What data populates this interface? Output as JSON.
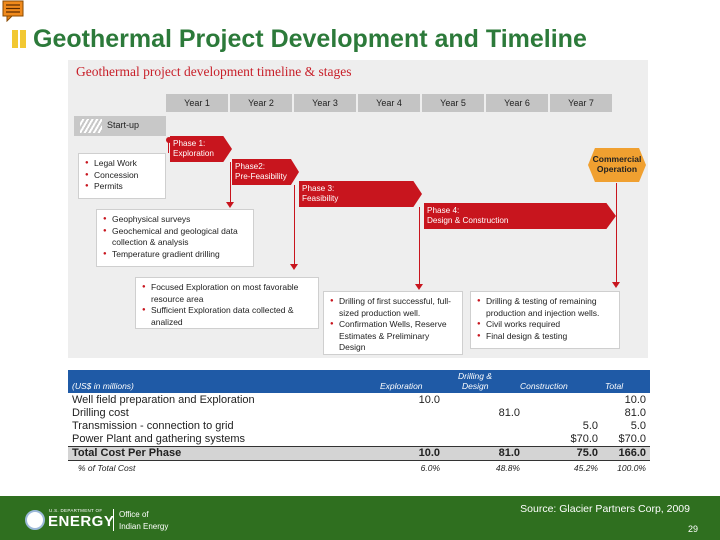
{
  "slide": {
    "title": "Geothermal Project Development and Timeline",
    "page_number": "29",
    "source": "Source: Glacier Partners Corp, 2009"
  },
  "diagram": {
    "title": "Geothermal project development timeline & stages",
    "years": [
      "Year 1",
      "Year 2",
      "Year 3",
      "Year 4",
      "Year 5",
      "Year 6",
      "Year 7"
    ],
    "startup": "Start-up",
    "phases": [
      {
        "line1": "Phase 1:",
        "line2": "Exploration"
      },
      {
        "line1": "Phase2:",
        "line2": "Pre-Feasibility"
      },
      {
        "line1": "Phase 3:",
        "line2": "Feasibility"
      },
      {
        "line1": "Phase 4:",
        "line2": "Design & Construction"
      }
    ],
    "commercial": {
      "line1": "Commercial",
      "line2": "Operation"
    },
    "boxes": [
      [
        "Legal Work",
        "Concession",
        "Permits"
      ],
      [
        "Geophysical surveys",
        "Geochemical and geological data collection & analysis",
        "Temperature gradient drilling"
      ],
      [
        "Focused Exploration on most favorable resource area",
        "Sufficient Exploration data collected & analized"
      ],
      [
        "Drilling of first successful, full-sized production well.",
        "Confirmation Wells, Reserve Estimates & Preliminary Design"
      ],
      [
        "Drilling & testing of remaining production and injection wells.",
        "Civil works required",
        "Final design & testing"
      ]
    ]
  },
  "table": {
    "header": {
      "units": "(US$ in millions)",
      "col1": "Exploration",
      "col2_line1": "Drilling &",
      "col2_line2": "Design",
      "col3": "Construction",
      "col4": "Total"
    },
    "rows": [
      {
        "label": "Well field preparation and Exploration",
        "exploration": "10.0",
        "drilling": "",
        "construction": "",
        "total": "10.0"
      },
      {
        "label": "Drilling cost",
        "exploration": "",
        "drilling": "81.0",
        "construction": "",
        "total": "81.0"
      },
      {
        "label": "Transmission - connection to grid",
        "exploration": "",
        "drilling": "",
        "construction": "5.0",
        "total": "5.0"
      },
      {
        "label": "Power Plant and gathering systems",
        "exploration": "",
        "drilling": "",
        "construction": "$70.0",
        "total": "$70.0"
      }
    ],
    "total_row": {
      "label": "Total Cost Per Phase",
      "exploration": "10.0",
      "drilling": "81.0",
      "construction": "75.0",
      "total": "166.0"
    },
    "pct_row": {
      "label": "% of Total Cost",
      "exploration": "6.0%",
      "drilling": "48.8%",
      "construction": "45.2%",
      "total": "100.0%"
    }
  },
  "footer": {
    "dept_small": "U.S. DEPARTMENT OF",
    "dept_big": "ENERGY",
    "office_line1": "Office of",
    "office_line2": "Indian Energy"
  },
  "colors": {
    "title_green": "#2c7a3a",
    "phase_red": "#c8151e",
    "commercial_orange": "#f0a030",
    "table_blue": "#1f5aa6",
    "footer_green": "#2f6f1f"
  }
}
